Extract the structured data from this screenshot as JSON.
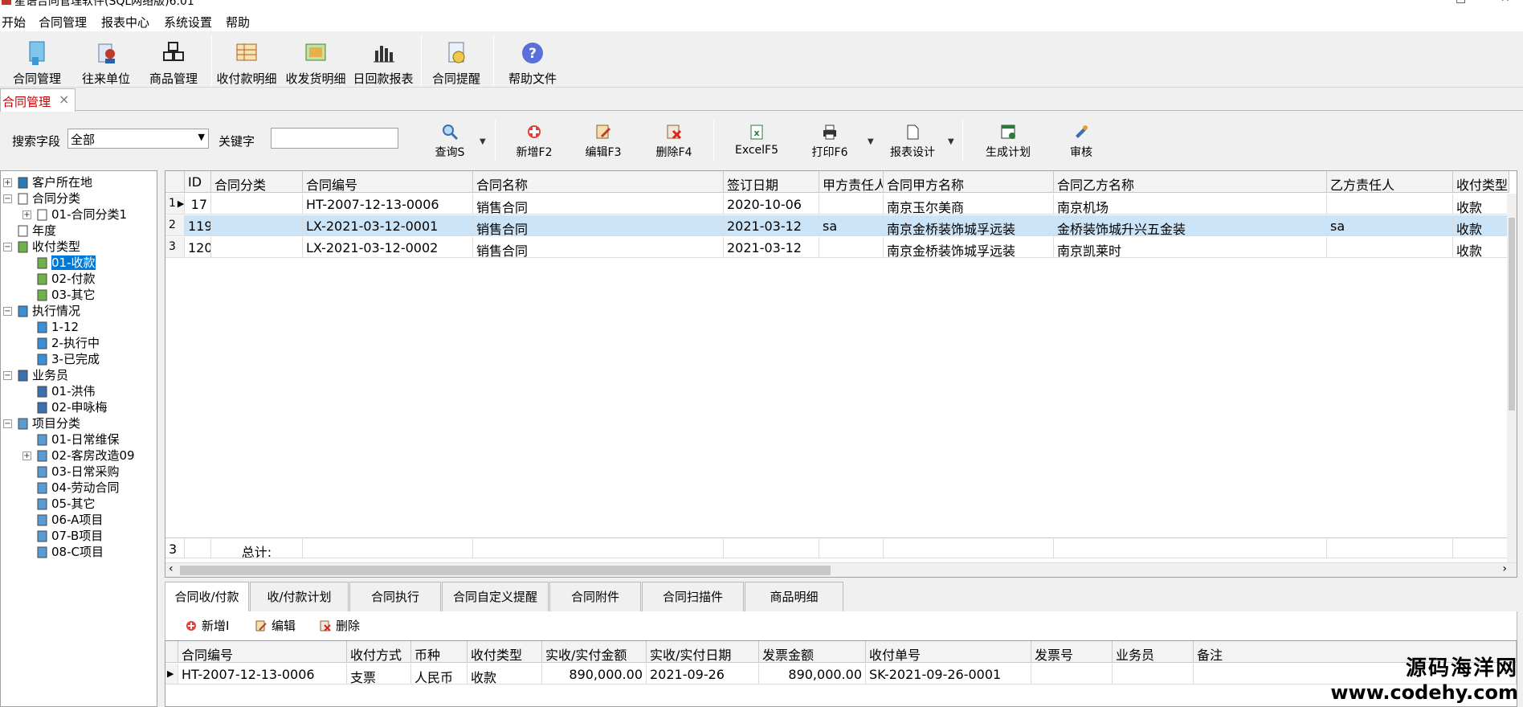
{
  "window": {
    "title": "星语合同管理软件(SQL网络版)6.01"
  },
  "menu": [
    "开始",
    "合同管理",
    "报表中心",
    "系统设置",
    "帮助"
  ],
  "toolbar": [
    {
      "label": "合同管理",
      "icon": "contract-doc-icon"
    },
    {
      "label": "往来单位",
      "icon": "partner-icon"
    },
    {
      "label": "商品管理",
      "icon": "goods-icon"
    },
    {
      "label": "收付款明细",
      "icon": "payment-detail-icon"
    },
    {
      "label": "收发货明细",
      "icon": "shipping-detail-icon"
    },
    {
      "label": "日回款报表",
      "icon": "daily-report-icon"
    },
    {
      "label": "合同提醒",
      "icon": "reminder-icon"
    },
    {
      "label": "帮助文件",
      "icon": "help-icon"
    }
  ],
  "doc_tab": {
    "label": "合同管理",
    "close": "×"
  },
  "search": {
    "field_label": "搜索字段",
    "field_value": "全部",
    "keyword_label": "关键字",
    "keyword_value": ""
  },
  "ribbon": [
    {
      "label": "查询S",
      "icon": "search-icon"
    },
    {
      "label": "新增F2",
      "icon": "add-icon"
    },
    {
      "label": "编辑F3",
      "icon": "edit-icon"
    },
    {
      "label": "删除F4",
      "icon": "delete-icon"
    },
    {
      "label": "ExcelF5",
      "icon": "excel-icon"
    },
    {
      "label": "打印F6",
      "icon": "print-icon"
    },
    {
      "label": "报表设计",
      "icon": "report-design-icon"
    },
    {
      "label": "生成计划",
      "icon": "plan-icon"
    },
    {
      "label": "审核",
      "icon": "approve-icon"
    }
  ],
  "tree": [
    {
      "label": "客户所在地",
      "level": 0,
      "exp": "+",
      "icon": "globe-icon"
    },
    {
      "label": "合同分类",
      "level": 0,
      "exp": "−",
      "icon": "document-icon"
    },
    {
      "label": "01-合同分类1",
      "level": 1,
      "exp": "+",
      "icon": "document-icon"
    },
    {
      "label": "年度",
      "level": 0,
      "exp": "",
      "icon": "clock-icon"
    },
    {
      "label": "收付类型",
      "level": 0,
      "exp": "−",
      "icon": "payment-type-icon"
    },
    {
      "label": "01-收款",
      "level": 1,
      "exp": "",
      "icon": "payment-type-icon",
      "selected": true
    },
    {
      "label": "02-付款",
      "level": 1,
      "exp": "",
      "icon": "payment-type-icon"
    },
    {
      "label": "03-其它",
      "level": 1,
      "exp": "",
      "icon": "payment-type-icon"
    },
    {
      "label": "执行情况",
      "level": 0,
      "exp": "−",
      "icon": "status-icon"
    },
    {
      "label": "1-12",
      "level": 1,
      "exp": "",
      "icon": "status-icon"
    },
    {
      "label": "2-执行中",
      "level": 1,
      "exp": "",
      "icon": "status-icon"
    },
    {
      "label": "3-已完成",
      "level": 1,
      "exp": "",
      "icon": "status-icon"
    },
    {
      "label": "业务员",
      "level": 0,
      "exp": "−",
      "icon": "person-icon"
    },
    {
      "label": "01-洪伟",
      "level": 1,
      "exp": "",
      "icon": "person-icon"
    },
    {
      "label": "02-申咏梅",
      "level": 1,
      "exp": "",
      "icon": "person-icon"
    },
    {
      "label": "项目分类",
      "level": 0,
      "exp": "−",
      "icon": "project-icon"
    },
    {
      "label": "01-日常维保",
      "level": 1,
      "exp": "",
      "icon": "project-icon"
    },
    {
      "label": "02-客房改造09",
      "level": 1,
      "exp": "+",
      "icon": "project-icon"
    },
    {
      "label": "03-日常采购",
      "level": 1,
      "exp": "",
      "icon": "project-icon"
    },
    {
      "label": "04-劳动合同",
      "level": 1,
      "exp": "",
      "icon": "project-icon"
    },
    {
      "label": "05-其它",
      "level": 1,
      "exp": "",
      "icon": "project-icon"
    },
    {
      "label": "06-A项目",
      "level": 1,
      "exp": "",
      "icon": "project-icon"
    },
    {
      "label": "07-B项目",
      "level": 1,
      "exp": "",
      "icon": "project-icon"
    },
    {
      "label": "08-C项目",
      "level": 1,
      "exp": "",
      "icon": "project-icon"
    }
  ],
  "grid": {
    "columns": [
      "ID",
      "合同分类",
      "合同编号",
      "合同名称",
      "签订日期",
      "甲方责任人",
      "合同甲方名称",
      "合同乙方名称",
      "乙方责任人",
      "收付类型"
    ],
    "rows": [
      {
        "num": "1",
        "cells": [
          "17",
          "",
          "HT-2007-12-13-0006",
          "销售合同",
          "2020-10-06",
          "",
          "南京玉尔美商",
          "南京机场",
          "",
          "收款"
        ]
      },
      {
        "num": "2",
        "cells": [
          "119",
          "",
          "LX-2021-03-12-0001",
          "销售合同",
          "2021-03-12",
          "sa",
          "南京金桥装饰城孚远装",
          "金桥装饰城升兴五金装",
          "sa",
          "收款"
        ],
        "selected": true
      },
      {
        "num": "3",
        "cells": [
          "120",
          "",
          "LX-2021-03-12-0002",
          "销售合同",
          "2021-03-12",
          "",
          "南京金桥装饰城孚远装",
          "南京凯莱时",
          "",
          "收款"
        ]
      }
    ],
    "footer": {
      "count": "3",
      "label": "总计:"
    },
    "scroll_right": "›",
    "scroll_left": "‹"
  },
  "bottom_tabs": [
    "合同收/付款",
    "收/付款计划",
    "合同执行",
    "合同自定义提醒",
    "合同附件",
    "合同扫描件",
    "商品明细"
  ],
  "bottom_actions": [
    {
      "label": "新增I",
      "icon": "add-icon"
    },
    {
      "label": "编辑",
      "icon": "edit-icon"
    },
    {
      "label": "删除",
      "icon": "delete-icon"
    }
  ],
  "bottom_grid": {
    "columns": [
      "合同编号",
      "收付方式",
      "币种",
      "收付类型",
      "实收/实付金额",
      "实收/实付日期",
      "发票金额",
      "收付单号",
      "发票号",
      "业务员",
      "备注"
    ],
    "rows": [
      [
        "HT-2007-12-13-0006",
        "支票",
        "人民币",
        "收款",
        "890,000.00",
        "2021-09-26",
        "890,000.00",
        "SK-2021-09-26-0001",
        "",
        "",
        ""
      ]
    ]
  },
  "watermark": {
    "line1": "源码海洋网",
    "line2": "www.codehy.com"
  },
  "colors": {
    "selection": "#0078d7",
    "row_highlight": "#cce4f7",
    "tab_text": "#c00000"
  }
}
